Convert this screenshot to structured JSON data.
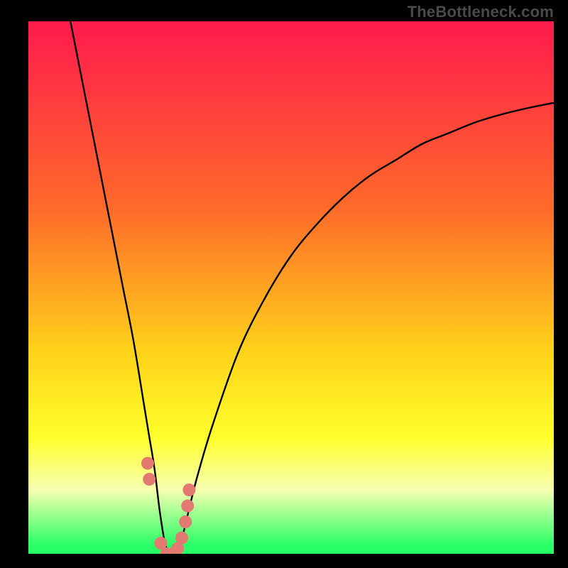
{
  "watermark": "TheBottleneck.com",
  "colors": {
    "top": "#ff1a4d",
    "mid1": "#ff6a2a",
    "mid2": "#ffd21a",
    "yellow": "#ffff2a",
    "pale": "#f6ffb0",
    "green": "#28ff66",
    "black": "#000000",
    "curve": "#000000",
    "marker": "#e27a72"
  },
  "chart_data": {
    "type": "line",
    "title": "",
    "xlabel": "",
    "ylabel": "",
    "xlim": [
      0,
      100
    ],
    "ylim": [
      0,
      100
    ],
    "series": [
      {
        "name": "bottleneck-curve",
        "x": [
          8,
          10,
          12,
          14,
          16,
          18,
          20,
          22,
          23,
          24,
          25,
          26,
          27,
          28,
          29,
          30,
          32,
          35,
          40,
          45,
          50,
          55,
          60,
          65,
          70,
          75,
          80,
          85,
          90,
          95,
          100
        ],
        "y": [
          100,
          90,
          80,
          70,
          60,
          50,
          40,
          28,
          22,
          16,
          8,
          2,
          0,
          0,
          2,
          6,
          14,
          24,
          38,
          48,
          56,
          62,
          67,
          71,
          74,
          77,
          79,
          81,
          82.5,
          83.7,
          84.7
        ]
      }
    ],
    "markers": {
      "name": "highlighted-points",
      "x": [
        22.7,
        23.0,
        25.2,
        26.3,
        27.5,
        28.4,
        29.2,
        29.9,
        30.3,
        30.6
      ],
      "y": [
        17,
        14,
        2,
        0,
        0,
        1,
        3,
        6,
        9,
        12
      ]
    },
    "gradient_stops": [
      {
        "offset": 0.0,
        "key": "top"
      },
      {
        "offset": 0.35,
        "key": "mid1"
      },
      {
        "offset": 0.62,
        "key": "mid2"
      },
      {
        "offset": 0.78,
        "key": "yellow"
      },
      {
        "offset": 0.88,
        "key": "pale"
      },
      {
        "offset": 0.985,
        "key": "green"
      },
      {
        "offset": 1.0,
        "key": "green"
      }
    ]
  }
}
